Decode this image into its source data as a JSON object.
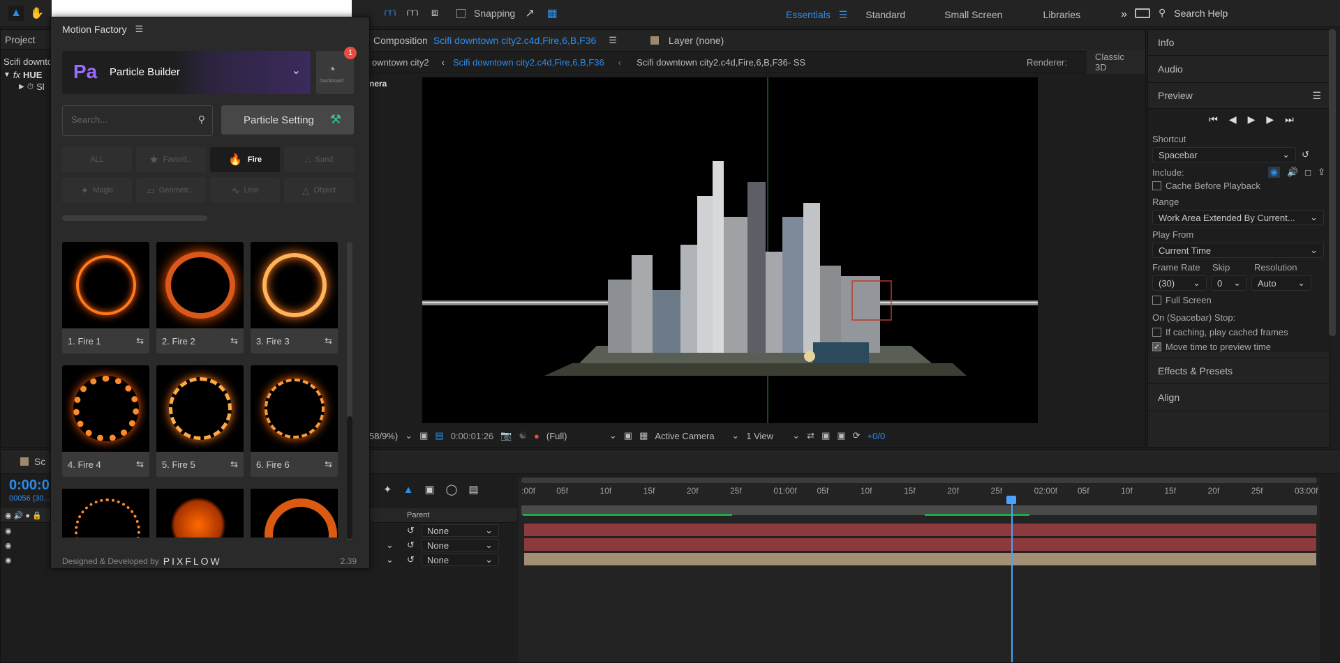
{
  "toolbar": {
    "snapping_label": "Snapping",
    "workspaces": [
      "Essentials",
      "Standard",
      "Small Screen",
      "Libraries"
    ],
    "search_placeholder": "Search Help"
  },
  "project_panel": {
    "tab_label": "Project",
    "item_name": "Scifi downto",
    "effect_label": "HUE",
    "sub_label": "Sl"
  },
  "composition": {
    "tab_prefix": "Composition",
    "tab_name": "Scifi downtown city2.c4d,Fire,6,B,F36",
    "layer_tab": "Layer (none)",
    "crumb_left": "owntown city2",
    "crumb_active": "Scifi downtown city2.c4d,Fire,6,B,F36",
    "crumb_right": "Scifi downtown city2.c4d,Fire,6,B,F36- SS",
    "renderer_label": "Renderer:",
    "renderer_value": "Classic 3D",
    "camera_label": "nera",
    "zoom": "58/9%)",
    "timecode": "0:00:01:26",
    "resolution": "(Full)",
    "camera_view": "Active Camera",
    "views": "1 View",
    "exposure": "+0/0"
  },
  "right_panel": {
    "info": "Info",
    "audio": "Audio",
    "preview": "Preview",
    "shortcut_label": "Shortcut",
    "shortcut_value": "Spacebar",
    "include_label": "Include:",
    "cache_before": "Cache Before Playback",
    "range_label": "Range",
    "range_value": "Work Area Extended By Current...",
    "play_from_label": "Play From",
    "play_from_value": "Current Time",
    "frame_rate_label": "Frame Rate",
    "skip_label": "Skip",
    "resolution_label": "Resolution",
    "frame_rate_value": "(30)",
    "skip_value": "0",
    "resolution_value": "Auto",
    "full_screen": "Full Screen",
    "on_stop": "On (Spacebar) Stop:",
    "if_caching": "If caching, play cached frames",
    "move_time": "Move time to preview time",
    "effects_presets": "Effects & Presets",
    "align": "Align"
  },
  "motion_factory": {
    "title": "Motion Factory",
    "product_abbr": "Pa",
    "product_name": "Particle Builder",
    "badge_count": "1",
    "dashboard_label": "Dashboard",
    "search_placeholder": "Search...",
    "particle_setting": "Particle Setting",
    "categories": [
      "ALL",
      "Favorit...",
      "Fire",
      "Sand",
      "Magic",
      "Geometr...",
      "Line",
      "Object"
    ],
    "active_category": "Fire",
    "items": [
      "1. Fire 1",
      "2. Fire 2",
      "3. Fire 3",
      "4. Fire 4",
      "5. Fire 5",
      "6. Fire 6"
    ],
    "footer_text": "Designed & Developed by",
    "footer_brand": "PIXFLOW",
    "version": "2.39"
  },
  "timeline": {
    "timecode": "0:00:0",
    "frames": "00056 (30...",
    "tab_label": "Sc",
    "parent_header": "Parent",
    "parent_values": [
      "None",
      "None",
      "None"
    ],
    "ruler_labels": [
      ":00f",
      "05f",
      "10f",
      "15f",
      "20f",
      "25f",
      "01:00f",
      "05f",
      "10f",
      "15f",
      "20f",
      "25f",
      "02:00f",
      "05f",
      "10f",
      "15f",
      "20f",
      "25f",
      "03:00f"
    ]
  },
  "colors": {
    "accent": "#2d8ceb",
    "layer_red": "#8d3a3c",
    "layer_tan": "#a38f73",
    "work_area": "#1fa84a",
    "fire": "#ff7a1a",
    "purple": "#9b6bff"
  }
}
